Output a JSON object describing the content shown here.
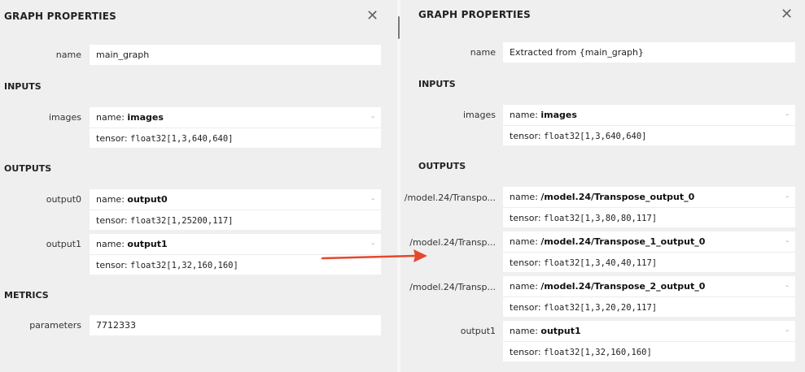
{
  "left": {
    "title": "GRAPH PROPERTIES",
    "name_label": "name",
    "name_value": "main_graph",
    "inputs_title": "INPUTS",
    "inputs": [
      {
        "label": "images",
        "name_prefix": "name: ",
        "name": "images",
        "tensor_prefix": "tensor: ",
        "tensor": "float32[1,3,640,640]"
      }
    ],
    "outputs_title": "OUTPUTS",
    "outputs": [
      {
        "label": "output0",
        "name_prefix": "name: ",
        "name": "output0",
        "tensor_prefix": "tensor: ",
        "tensor": "float32[1,25200,117]"
      },
      {
        "label": "output1",
        "name_prefix": "name: ",
        "name": "output1",
        "tensor_prefix": "tensor: ",
        "tensor": "float32[1,32,160,160]"
      }
    ],
    "metrics_title": "METRICS",
    "parameters_label": "parameters",
    "parameters_value": "7712333"
  },
  "right": {
    "title": "GRAPH PROPERTIES",
    "name_label": "name",
    "name_value": "Extracted from {main_graph}",
    "inputs_title": "INPUTS",
    "inputs": [
      {
        "label": "images",
        "name_prefix": "name: ",
        "name": "images",
        "tensor_prefix": "tensor: ",
        "tensor": "float32[1,3,640,640]"
      }
    ],
    "outputs_title": "OUTPUTS",
    "outputs": [
      {
        "label": "/model.24/Transpo...",
        "name_prefix": "name: ",
        "name": "/model.24/Transpose_output_0",
        "tensor_prefix": "tensor: ",
        "tensor": "float32[1,3,80,80,117]"
      },
      {
        "label": "/model.24/Transp...",
        "name_prefix": "name: ",
        "name": "/model.24/Transpose_1_output_0",
        "tensor_prefix": "tensor: ",
        "tensor": "float32[1,3,40,40,117]"
      },
      {
        "label": "/model.24/Transp...",
        "name_prefix": "name: ",
        "name": "/model.24/Transpose_2_output_0",
        "tensor_prefix": "tensor: ",
        "tensor": "float32[1,3,20,20,117]"
      },
      {
        "label": "output1",
        "name_prefix": "name: ",
        "name": "output1",
        "tensor_prefix": "tensor: ",
        "tensor": "float32[1,32,160,160]"
      }
    ]
  },
  "icons": {
    "close": "close-icon",
    "collapse": "dash-icon",
    "arrow": "arrow-right-icon"
  },
  "colors": {
    "arrow": "#e5472f",
    "panel_bg": "#efefef",
    "box_bg": "#ffffff"
  },
  "glyphs": {
    "close": "✕",
    "dash": "-"
  }
}
